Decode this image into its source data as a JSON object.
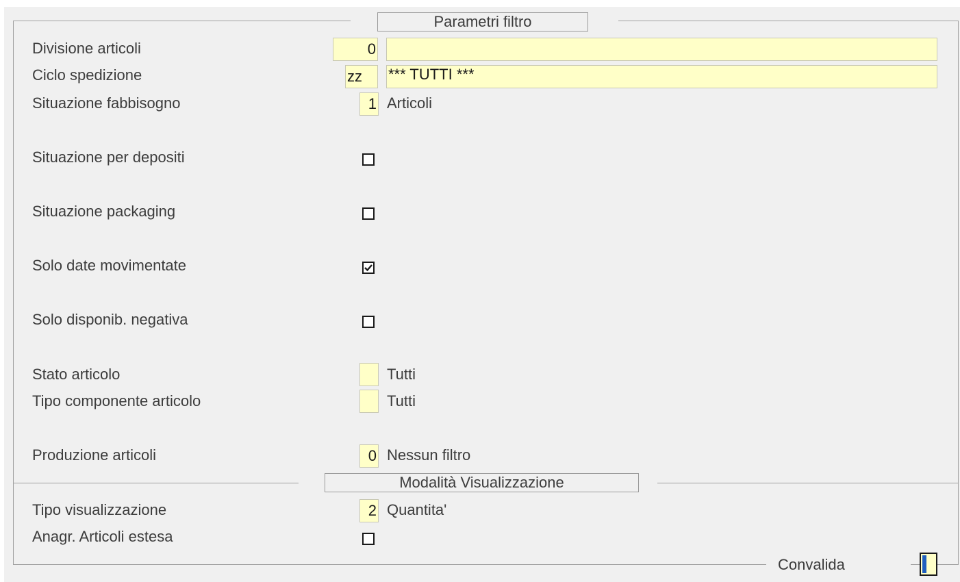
{
  "filter_params": {
    "title": "Parametri filtro",
    "divisione_articoli": {
      "label": "Divisione articoli",
      "code": "0",
      "description": ""
    },
    "ciclo_spedizione": {
      "label": "Ciclo spedizione",
      "code": "zz",
      "description": "*** TUTTI ***"
    },
    "situazione_fabbisogno": {
      "label": "Situazione fabbisogno",
      "code": "1",
      "description": "Articoli"
    },
    "situazione_depositi": {
      "label": "Situazione per depositi",
      "checked": false
    },
    "situazione_packaging": {
      "label": "Situazione packaging",
      "checked": false
    },
    "solo_date_movimentate": {
      "label": "Solo date movimentate",
      "checked": true
    },
    "solo_disponib_negativa": {
      "label": "Solo disponib. negativa",
      "checked": false
    },
    "stato_articolo": {
      "label": "Stato articolo",
      "code": "",
      "description": "Tutti"
    },
    "tipo_componente": {
      "label": "Tipo componente articolo",
      "code": "",
      "description": "Tutti"
    },
    "produzione_articoli": {
      "label": "Produzione articoli",
      "code": "0",
      "description": "Nessun filtro"
    }
  },
  "display_mode": {
    "title": "Modalità Visualizzazione",
    "tipo_visualizzazione": {
      "label": "Tipo visualizzazione",
      "code": "2",
      "description": "Quantita'"
    },
    "anagr_estesa": {
      "label": "Anagr. Articoli estesa",
      "checked": false
    }
  },
  "footer": {
    "confirm_label": "Convalida"
  },
  "colors": {
    "field_bg": "#ffffc8",
    "panel_bg": "#f0f0f0",
    "accent": "#1f5fbf"
  }
}
